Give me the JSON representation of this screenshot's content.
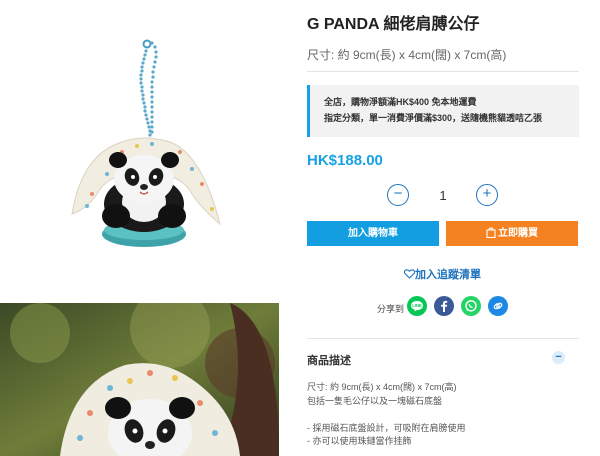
{
  "product": {
    "title": "G PANDA 細佬肩膊公仔",
    "size": "尺寸: 約 9cm(長) x 4cm(闊) x 7cm(高)",
    "price": "HK$188.00"
  },
  "notice": {
    "line1": "全店，購物淨額滿HK$400 免本地運費",
    "line2": "指定分類，單一消費淨價滿$300，送隨機熊貓透咭乙張"
  },
  "quantity": {
    "minus": "−",
    "value": "1",
    "plus": "+"
  },
  "actions": {
    "add_to_cart": "加入購物車",
    "buy_now": "立即購買",
    "wishlist": "加入追蹤清單"
  },
  "share": {
    "label": "分享到",
    "icons": [
      "line-icon",
      "facebook-icon",
      "whatsapp-icon",
      "link-icon"
    ],
    "colors": {
      "line": "#06c755",
      "facebook": "#3b5998",
      "whatsapp": "#25d366",
      "link": "#1e88e5"
    }
  },
  "description": {
    "heading": "商品描述",
    "toggle": "−",
    "lines": [
      "尺寸: 約 9cm(長) x 4cm(闊) x 7cm(高)",
      "包括一隻毛公仔以及一塊磁石底盤",
      "",
      "- 採用磁石底盤設計，可吸附在肩膀使用",
      "- 亦可以使用珠鏈當作挂飾"
    ]
  },
  "colors": {
    "accent": "#17a2e3",
    "cart_button": "#129ee0",
    "buy_button": "#f58220",
    "link": "#1e73be"
  }
}
